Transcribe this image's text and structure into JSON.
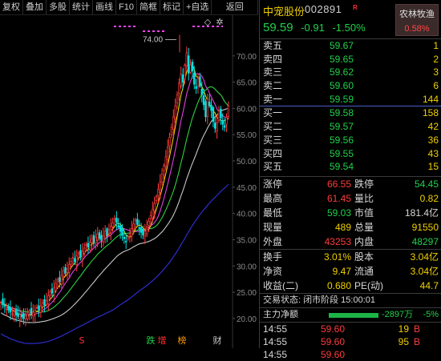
{
  "toolbar": {
    "items": [
      "复权",
      "叠加",
      "多股",
      "统计",
      "画线",
      "F10",
      "简框",
      "标记",
      "+自选",
      "返回"
    ]
  },
  "chart": {
    "y_ticks": [
      "70.00",
      "65.00",
      "60.00",
      "55.00",
      "50.00",
      "45.00",
      "40.00",
      "35.00",
      "30.00",
      "25.00",
      "20.00"
    ],
    "peak_label": "74.00",
    "bottom_markers": [
      {
        "text": "S",
        "color": "#ff3030"
      },
      {
        "text": "跌",
        "color": "#21d04a"
      },
      {
        "text": "增",
        "color": "#ff3030"
      },
      {
        "text": "榜",
        "color": "#ff9a00"
      },
      {
        "text": "财",
        "color": "#c8c8c8"
      }
    ]
  },
  "chart_data": {
    "type": "candlestick",
    "ylim": [
      18,
      75
    ],
    "close": [
      23.1,
      22.6,
      22.3,
      22.0,
      21.6,
      21.2,
      20.9,
      21.3,
      20.7,
      20.4,
      20.8,
      20.3,
      20.0,
      20.5,
      20.9,
      21.4,
      20.8,
      21.2,
      21.6,
      22.1,
      21.7,
      22.4,
      23.0,
      22.6,
      23.4,
      24.3,
      25.1,
      24.8,
      25.8,
      26.6,
      27.4,
      27.0,
      28.2,
      29.1,
      28.6,
      29.4,
      30.3,
      30.9,
      31.6,
      30.8,
      31.9,
      32.5,
      31.7,
      32.8,
      33.4,
      34.1,
      33.6,
      34.5,
      35.2,
      34.4,
      35.5,
      36.1,
      35.3,
      34.9,
      35.8,
      36.6,
      35.9,
      36.9,
      37.6,
      38.2,
      39.1,
      38.3,
      37.4,
      36.6,
      35.8,
      35.2,
      34.7,
      35.5,
      36.2,
      37.1,
      38.0,
      38.8,
      37.9,
      37.2,
      36.4,
      35.9,
      36.6,
      37.4,
      38.5,
      39.6,
      40.8,
      41.9,
      43.2,
      44.6,
      46.0,
      47.5,
      49.1,
      50.8,
      52.6,
      54.5,
      56.4,
      58.4,
      60.5,
      62.6,
      64.8,
      66.5,
      65.0,
      68.2,
      70.6,
      66.7,
      68.3,
      67.1,
      64.6,
      63.8,
      65.7,
      64.2,
      62.6,
      60.7,
      58.4,
      61.8,
      60.5,
      59.6,
      57.5,
      56.2,
      57.3,
      59.5,
      58.2,
      57.0,
      56.4,
      58.3,
      60.5
    ],
    "current_price": 59.59,
    "peak": 74.0
  },
  "stock": {
    "name": "中宠股份",
    "code": "002891",
    "badge": "R",
    "price": "59.59",
    "change": "-0.91",
    "pct": "-1.50%",
    "sector": "农林牧渔",
    "sector_pct": "0.58%"
  },
  "orderbook": {
    "asks": [
      {
        "label": "卖五",
        "price": "59.67",
        "vol": "1"
      },
      {
        "label": "卖四",
        "price": "59.65",
        "vol": "2"
      },
      {
        "label": "卖三",
        "price": "59.62",
        "vol": "3"
      },
      {
        "label": "卖二",
        "price": "59.60",
        "vol": "6"
      },
      {
        "label": "卖一",
        "price": "59.59",
        "vol": "144"
      }
    ],
    "bids": [
      {
        "label": "买一",
        "price": "59.58",
        "vol": "158"
      },
      {
        "label": "买二",
        "price": "59.57",
        "vol": "42"
      },
      {
        "label": "买三",
        "price": "59.56",
        "vol": "36"
      },
      {
        "label": "买四",
        "price": "59.55",
        "vol": "43"
      },
      {
        "label": "买五",
        "price": "59.54",
        "vol": "15"
      }
    ]
  },
  "quote": {
    "rows1": [
      {
        "a": "涨停",
        "b": "66.55",
        "bc": "red",
        "c": "跌停",
        "d": "54.45",
        "dc": "green"
      },
      {
        "a": "最高",
        "b": "61.45",
        "bc": "red",
        "c": "量比",
        "d": "0.82",
        "dc": "yellow"
      },
      {
        "a": "最低",
        "b": "59.03",
        "bc": "green",
        "c": "市值",
        "d": "181.4亿",
        "dc": "white"
      },
      {
        "a": "现量",
        "b": "489",
        "bc": "white",
        "c": "总量",
        "d": "91550",
        "dc": "white"
      },
      {
        "a": "外盘",
        "b": "43253",
        "bc": "red",
        "c": "内盘",
        "d": "48297",
        "dc": "green"
      }
    ],
    "rows2": [
      {
        "a": "换手",
        "b": "3.01%",
        "bc": "white",
        "c": "股本",
        "d": "3.04亿",
        "dc": "white"
      },
      {
        "a": "净资",
        "b": "9.47",
        "bc": "white",
        "c": "流通",
        "d": "3.04亿",
        "dc": "white"
      },
      {
        "a": "收益(二)",
        "b": "0.680",
        "bc": "white",
        "c": "PE(动)",
        "d": "44.7",
        "dc": "white"
      }
    ]
  },
  "status": {
    "label": "交易状态: 闭市阶段 15:00:01"
  },
  "fund_flow": {
    "label": "主力净额",
    "amount": "-2897万",
    "pct": "-5%",
    "bar_color": "#1db446"
  },
  "ticks": [
    {
      "time": "14:55",
      "price": "59.60",
      "vol": "19",
      "flag": "B"
    },
    {
      "time": "14:55",
      "price": "59.60",
      "vol": "95",
      "flag": "B"
    },
    {
      "time": "14:55",
      "price": "59.60",
      "vol": "",
      "flag": ""
    }
  ]
}
